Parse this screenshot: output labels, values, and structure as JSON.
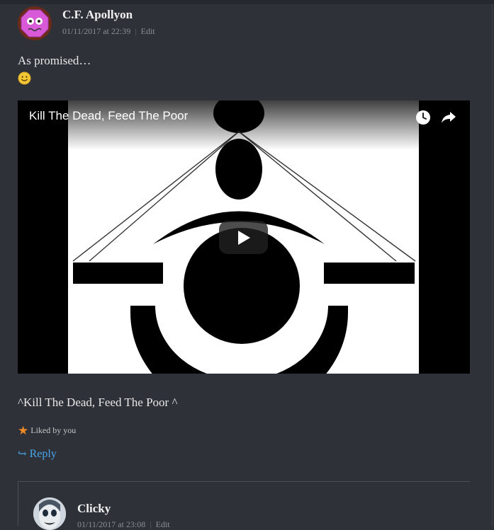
{
  "comment": {
    "author": "C.F. Apollyon",
    "timestamp": "01/11/2017 at 22:39",
    "edit_label": "Edit",
    "separator": "|",
    "text": "As promised…",
    "emoji": "smile-emoji",
    "caption": "^Kill The Dead, Feed The Poor ^",
    "liked_label": "Liked by you",
    "reply_label": "Reply"
  },
  "video": {
    "title": "Kill The Dead, Feed The Poor",
    "icons": [
      "clock-icon",
      "share-icon",
      "play-icon"
    ]
  },
  "reply_comment": {
    "author": "Clicky",
    "timestamp": "01/11/2017 at 23:08",
    "edit_label": "Edit"
  },
  "colors": {
    "background": "#2e3138",
    "link": "#49a6e9",
    "star": "#f08a24"
  }
}
